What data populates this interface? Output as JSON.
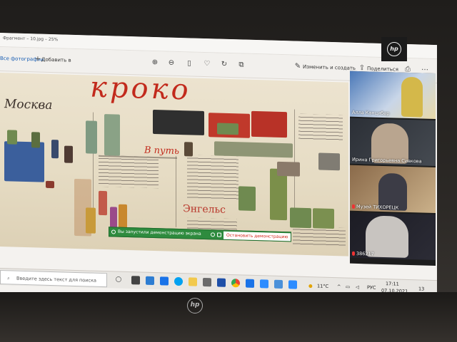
{
  "photos_app": {
    "title": "Фрагмент – 10.jpg – 25%",
    "add_to_album": "Добавить в",
    "left_label": "Все фотографии",
    "edit_create": "Изменить и создать",
    "share_label": "Поделиться",
    "icons": [
      "zoom-in-icon",
      "zoom-out-icon",
      "delete-icon",
      "heart-icon",
      "rotate-icon",
      "crop-icon",
      "edit-icon",
      "share-icon",
      "print-icon",
      "more-icon"
    ]
  },
  "photo": {
    "heading_word": "кроко",
    "moskva": "Москва",
    "v_put": "В путь",
    "engels": "Энгельс"
  },
  "share_bar": {
    "status": "Вы запустили демонстрацию экрана",
    "stop": "Остановить демонстрацию"
  },
  "participants": [
    {
      "name": "Алла Канцибер"
    },
    {
      "name": "Ирина Григорьевна Сивкова"
    },
    {
      "name": "Музей ТИХОРЕЦК"
    },
    {
      "name": "386217"
    }
  ],
  "taskbar": {
    "search_placeholder": "Введите здесь текст для поиска",
    "weather": "11°C",
    "language": "РУС",
    "time": "17:11",
    "date": "07.10.2021",
    "notifications": "13"
  },
  "laptop": {
    "brand": "hp"
  },
  "colors": {
    "share_green": "#2e8b3e",
    "stop_red": "#d2261b",
    "ink_red": "#c22a1c",
    "accent_blue": "#1b5fb4"
  }
}
